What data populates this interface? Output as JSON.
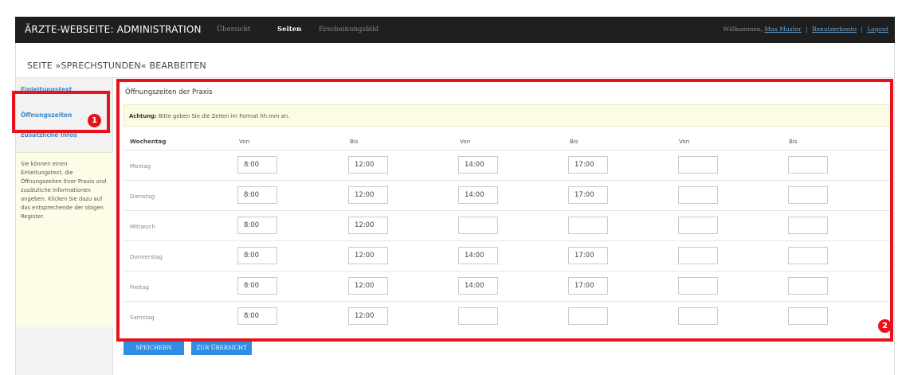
{
  "app_title": "ÄRZTE-WEBSEITE: ADMINISTRATION",
  "nav": [
    {
      "label": "Übersicht",
      "active": false
    },
    {
      "label": "Seiten",
      "active": true
    },
    {
      "label": "Erscheinungsbild",
      "active": false
    }
  ],
  "user": {
    "welcome": "Willkommen,",
    "name": "Max Muster",
    "account": "Benutzerkonto",
    "logout": "Logout"
  },
  "page_title": "SEITE »SPRECHSTUNDEN« BEARBEITEN",
  "sidebar": {
    "items": [
      "Einleitungstext",
      "Öffnungszeiten",
      "zusätzliche Infos"
    ],
    "hint": "Sie können einen Einleitungstext, die Öffnungszeiten Ihrer Praxis und zusätzliche Informationen angeben. Klicken Sie dazu auf das entsprechende der obigen Register."
  },
  "main": {
    "section_title": "Öffnungszeiten der Praxis",
    "notice_strong": "Achtung:",
    "notice_text": "Bitte geben Sie die Zeiten im Format hh:mm an.",
    "headers": [
      "Wochentag",
      "Von",
      "Bis",
      "Von",
      "Bis",
      "Von",
      "Bis"
    ],
    "rows": [
      {
        "day": "Montag",
        "times": [
          "8:00",
          "12:00",
          "14:00",
          "17:00",
          "",
          ""
        ]
      },
      {
        "day": "Dienstag",
        "times": [
          "8:00",
          "12:00",
          "14:00",
          "17:00",
          "",
          ""
        ]
      },
      {
        "day": "Mittwoch",
        "times": [
          "8:00",
          "12:00",
          "",
          "",
          "",
          ""
        ]
      },
      {
        "day": "Donnerstag",
        "times": [
          "8:00",
          "12:00",
          "14:00",
          "17:00",
          "",
          ""
        ]
      },
      {
        "day": "Freitag",
        "times": [
          "8:00",
          "12:00",
          "14:00",
          "17:00",
          "",
          ""
        ]
      },
      {
        "day": "Samstag",
        "times": [
          "8:00",
          "12:00",
          "",
          "",
          "",
          ""
        ]
      }
    ]
  },
  "buttons": {
    "save": "SPEICHERN",
    "overview": "ZUR ÜBERSICHT"
  },
  "annotations": {
    "badge1": "1",
    "badge2": "2",
    "color": "#e8121c"
  }
}
